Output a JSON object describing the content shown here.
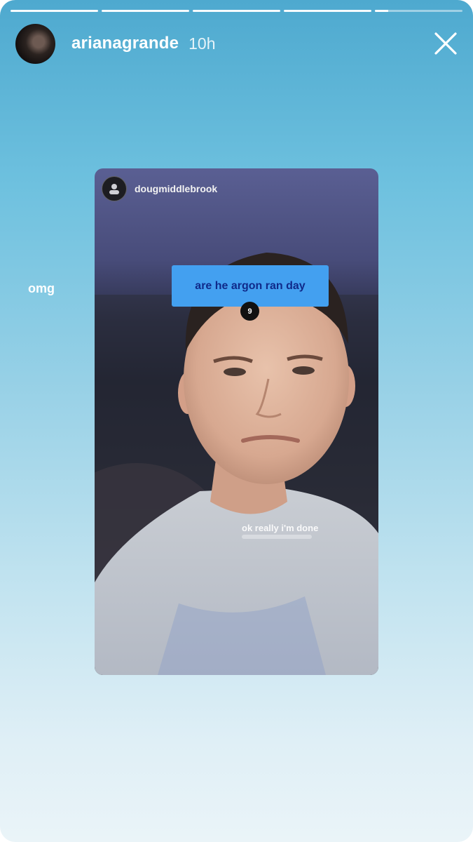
{
  "story": {
    "username": "arianagrande",
    "time": "10h",
    "segments": 5,
    "current_segment": 5,
    "current_segment_progress": 0.15,
    "side_text": "omg"
  },
  "icons": {
    "close": "close-icon",
    "avatar": "avatar"
  },
  "shared_post": {
    "username": "dougmiddlebrook",
    "question_sticker": "are he argon ran day",
    "question_count": "9",
    "caption": "ok really i'm done"
  },
  "colors": {
    "sticker_bg": "#43a0f0",
    "sticker_text": "#102a8a"
  }
}
